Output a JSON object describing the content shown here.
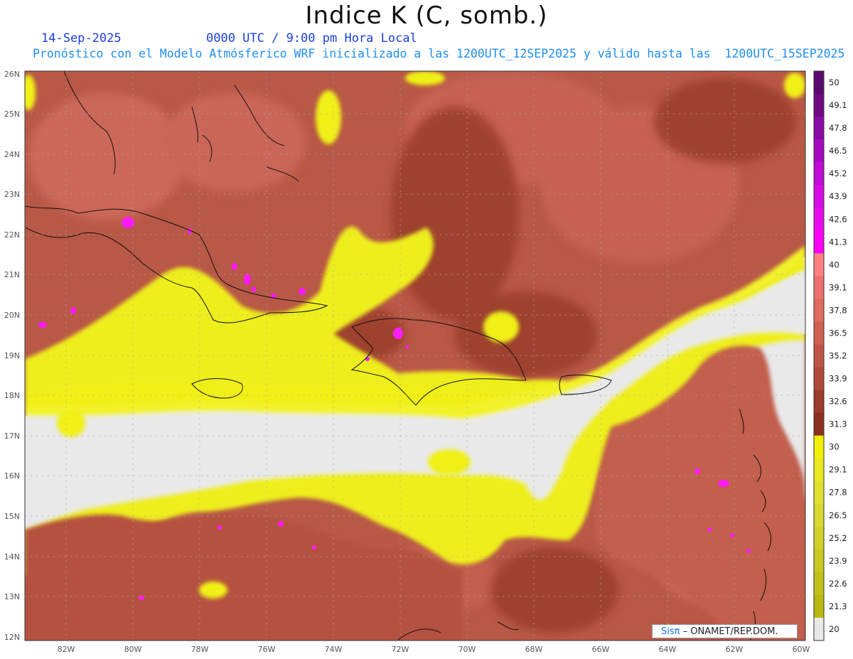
{
  "header": {
    "title": "Indice K (C, somb.)",
    "date": "14-Sep-2025",
    "time": "0000 UTC / 9:00 pm Hora Local",
    "model_info": "Pronóstico con el Modelo Atmósferico WRF inicializado a las 1200UTC_12SEP2025 y válido hasta las  1200UTC_15SEP2025"
  },
  "map": {
    "lat_labels": [
      "26N",
      "25N",
      "24N",
      "23N",
      "22N",
      "21N",
      "20N",
      "19N",
      "18N",
      "17N",
      "16N",
      "15N",
      "14N",
      "13N",
      "12N"
    ],
    "lon_labels": [
      "82W",
      "80W",
      "78W",
      "76W",
      "74W",
      "72W",
      "70W",
      "68W",
      "66W",
      "64W",
      "62W",
      "60W"
    ],
    "colors": {
      "background_low": "#e8e8e8",
      "yellow": "#f2f214",
      "yellow_bright": "#f8f840",
      "red_dark": "#9c3f2d",
      "red_mid": "#b85846",
      "red_light": "#d46f62",
      "magenta": "#ff1aff"
    }
  },
  "colorbar": {
    "labels": [
      "50",
      "49.1",
      "47.8",
      "46.5",
      "45.2",
      "43.9",
      "42.6",
      "41.3",
      "40",
      "39.1",
      "37.8",
      "36.5",
      "35.2",
      "33.9",
      "32.6",
      "31.3",
      "30",
      "29.1",
      "27.8",
      "26.5",
      "25.2",
      "23.9",
      "22.6",
      "21.3",
      "20"
    ],
    "colors": [
      "#5a0a6e",
      "#6e0a85",
      "#8a0aa5",
      "#a50ac0",
      "#c00ad6",
      "#d80ae6",
      "#ea0af0",
      "#ff00ff",
      "#ff8080",
      "#f07070",
      "#e06a5e",
      "#d06050",
      "#c05444",
      "#b04838",
      "#9c3c2c",
      "#8a3020",
      "#f0f000",
      "#e8e820",
      "#e0e030",
      "#d8d830",
      "#d0d028",
      "#c8c820",
      "#c0c018",
      "#b8b810",
      "#e8e8e8"
    ]
  },
  "credit": {
    "brand": "Sisπ",
    "text": "– ONAMET/REP.DOM."
  }
}
